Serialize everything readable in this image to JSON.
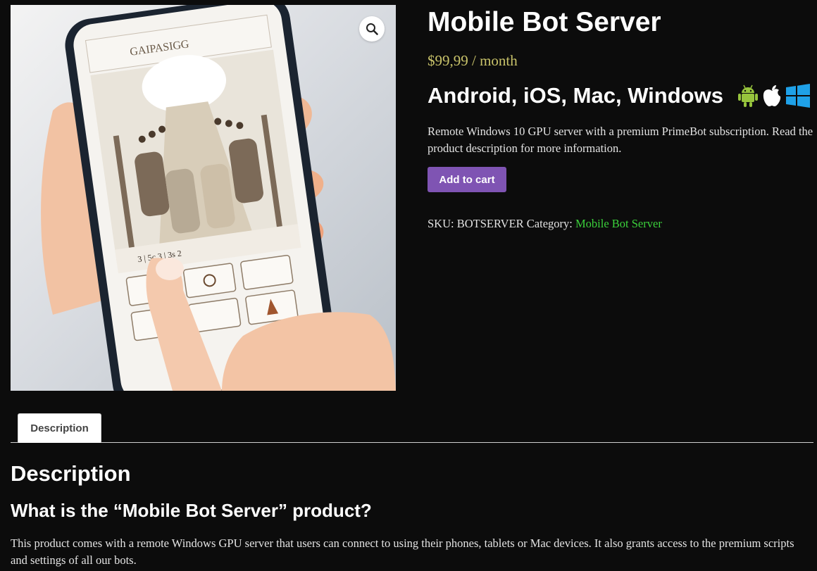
{
  "product": {
    "title": "Mobile Bot Server",
    "price": "$99,99 / month",
    "platforms": "Android, iOS, Mac, Windows",
    "platform_icons": [
      "android-icon",
      "apple-icon",
      "windows-icon"
    ],
    "short_description": "Remote Windows 10 GPU server with a premium PrimeBot subscription. Read the product description for more information.",
    "add_to_cart_label": "Add to cart",
    "sku_label": "SKU:",
    "sku": "BOTSERVER",
    "category_label": "Category:",
    "category": "Mobile Bot Server"
  },
  "image": {
    "zoom_icon": "magnifier-icon",
    "phone_screen_title": "GAIPASIGG",
    "phone_status": "3 | 5c.3 | 3s 2"
  },
  "tabs": [
    {
      "label": "Description",
      "active": true
    }
  ],
  "description": {
    "heading": "Description",
    "subheading": "What is the “Mobile Bot Server” product?",
    "body": "This product comes with a remote Windows GPU server that users can connect to using their phones, tablets or Mac devices. It also grants access to the premium scripts and settings of all our bots."
  },
  "colors": {
    "background": "#0c0c0c",
    "price": "#c9c36a",
    "button": "#7f54b3",
    "category_link": "#3bd13b",
    "android": "#97c43d",
    "windows": "#1fa1e8"
  }
}
